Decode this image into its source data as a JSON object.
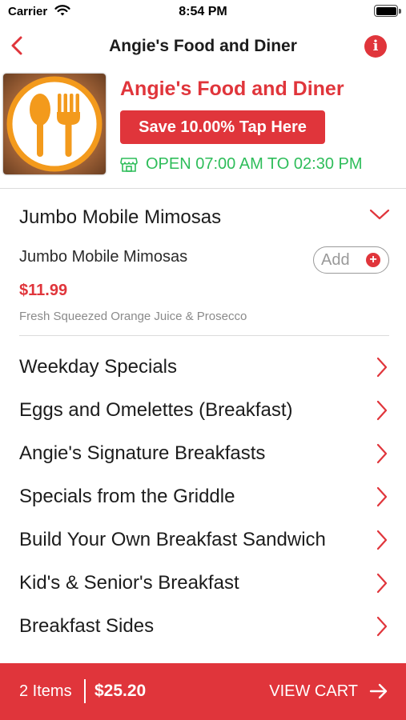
{
  "status_bar": {
    "carrier": "Carrier",
    "time": "8:54 PM"
  },
  "nav": {
    "title": "Angie's Food and Diner",
    "info_icon": "info-icon",
    "back_icon": "chevron-left-icon"
  },
  "restaurant": {
    "name": "Angie's Food and Diner",
    "promo_button": "Save 10.00% Tap Here",
    "hours": "OPEN 07:00 AM TO 02:30 PM",
    "hours_icon": "storefront-icon",
    "logo_icon": "spoon-fork-icon"
  },
  "expanded_section": {
    "title": "Jumbo Mobile Mimosas",
    "items": [
      {
        "name": "Jumbo Mobile Mimosas",
        "price": "$11.99",
        "description": "Fresh Squeezed Orange Juice & Prosecco",
        "add_label": "Add",
        "add_icon": "+"
      }
    ]
  },
  "categories": [
    "Weekday Specials",
    "Eggs and Omelettes (Breakfast)",
    "Angie's Signature Breakfasts",
    "Specials from the Griddle",
    "Build Your Own Breakfast Sandwich",
    "Kid's & Senior's Breakfast",
    "Breakfast Sides"
  ],
  "cart": {
    "items": "2 Items",
    "total": "$25.20",
    "action": "VIEW CART"
  },
  "colors": {
    "accent": "#e0353b",
    "open_green": "#2ebd5a",
    "text": "#1c1c1c",
    "muted": "#8a8a8a"
  }
}
